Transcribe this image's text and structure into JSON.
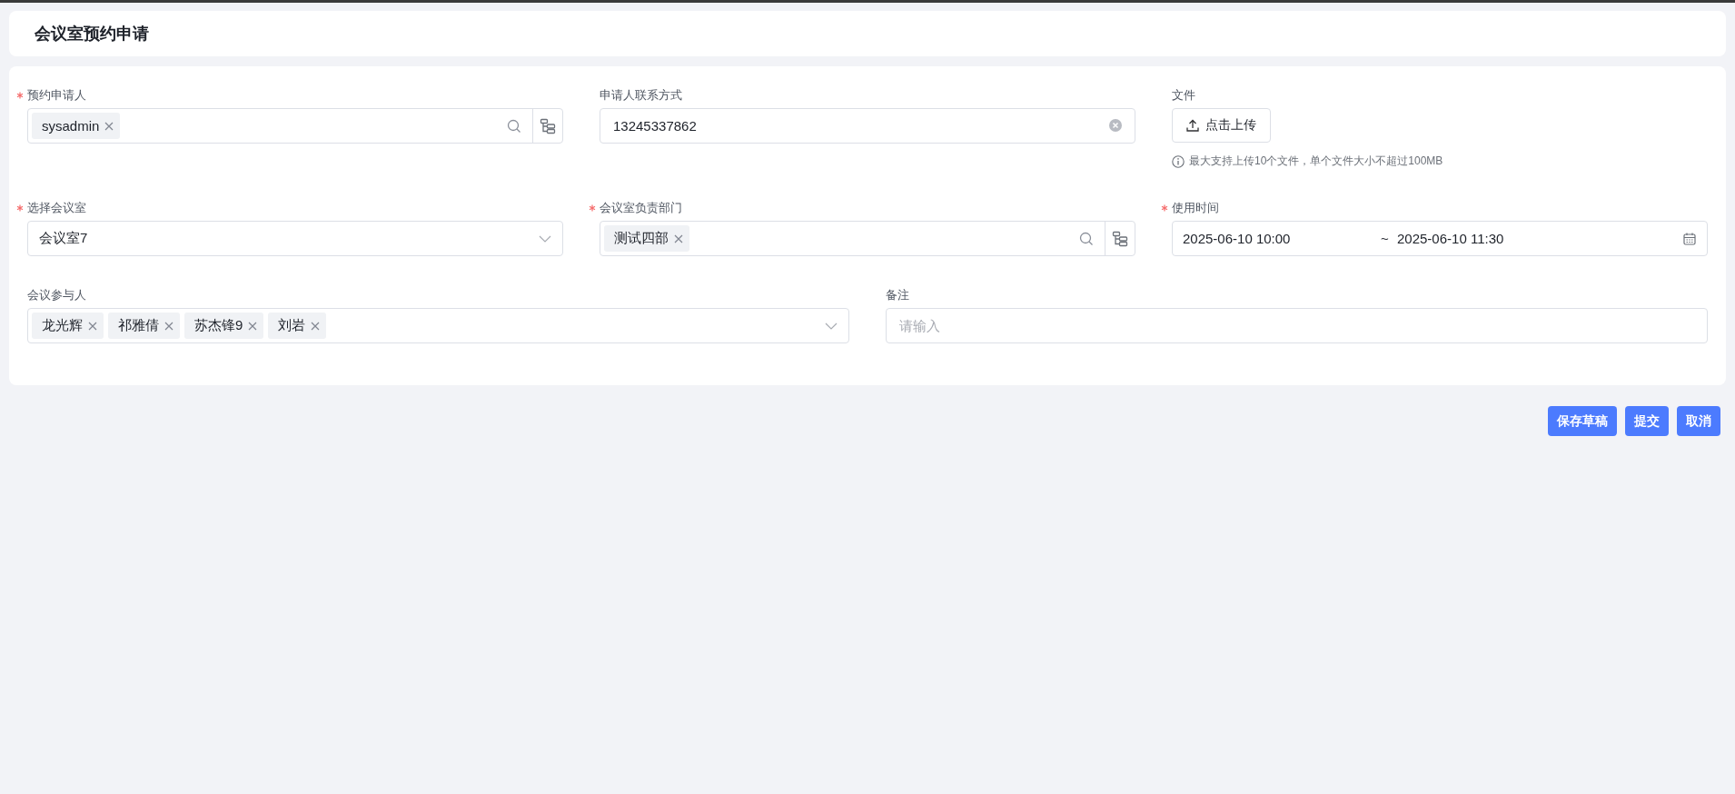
{
  "title": "会议室预约申请",
  "form": {
    "rows": [
      [
        {
          "kind": "picker",
          "label": "预约申请人",
          "required": true,
          "tags": [
            "sysadmin"
          ]
        },
        {
          "kind": "text",
          "label": "申请人联系方式",
          "required": false,
          "value": "13245337862",
          "clearable": true
        },
        {
          "kind": "upload",
          "label": "文件",
          "required": false,
          "button": "点击上传",
          "hint": "最大支持上传10个文件，单个文件大小不超过100MB"
        }
      ],
      [
        {
          "kind": "select",
          "label": "选择会议室",
          "required": true,
          "value": "会议室7"
        },
        {
          "kind": "picker",
          "label": "会议室负责部门",
          "required": true,
          "tags": [
            "测试四部"
          ]
        },
        {
          "kind": "daterange",
          "label": "使用时间",
          "required": true,
          "start": "2025-06-10 10:00",
          "separator": "~",
          "end": "2025-06-10 11:30"
        }
      ],
      [
        {
          "kind": "tagselect",
          "label": "会议参与人",
          "required": false,
          "tags": [
            "龙光辉",
            "祁雅倩",
            "苏杰锋9",
            "刘岩"
          ]
        },
        {
          "kind": "text",
          "label": "备注",
          "required": false,
          "placeholder": "请输入",
          "clearable": false
        }
      ]
    ]
  },
  "buttons": [
    "保存草稿",
    "提交",
    "取消"
  ]
}
